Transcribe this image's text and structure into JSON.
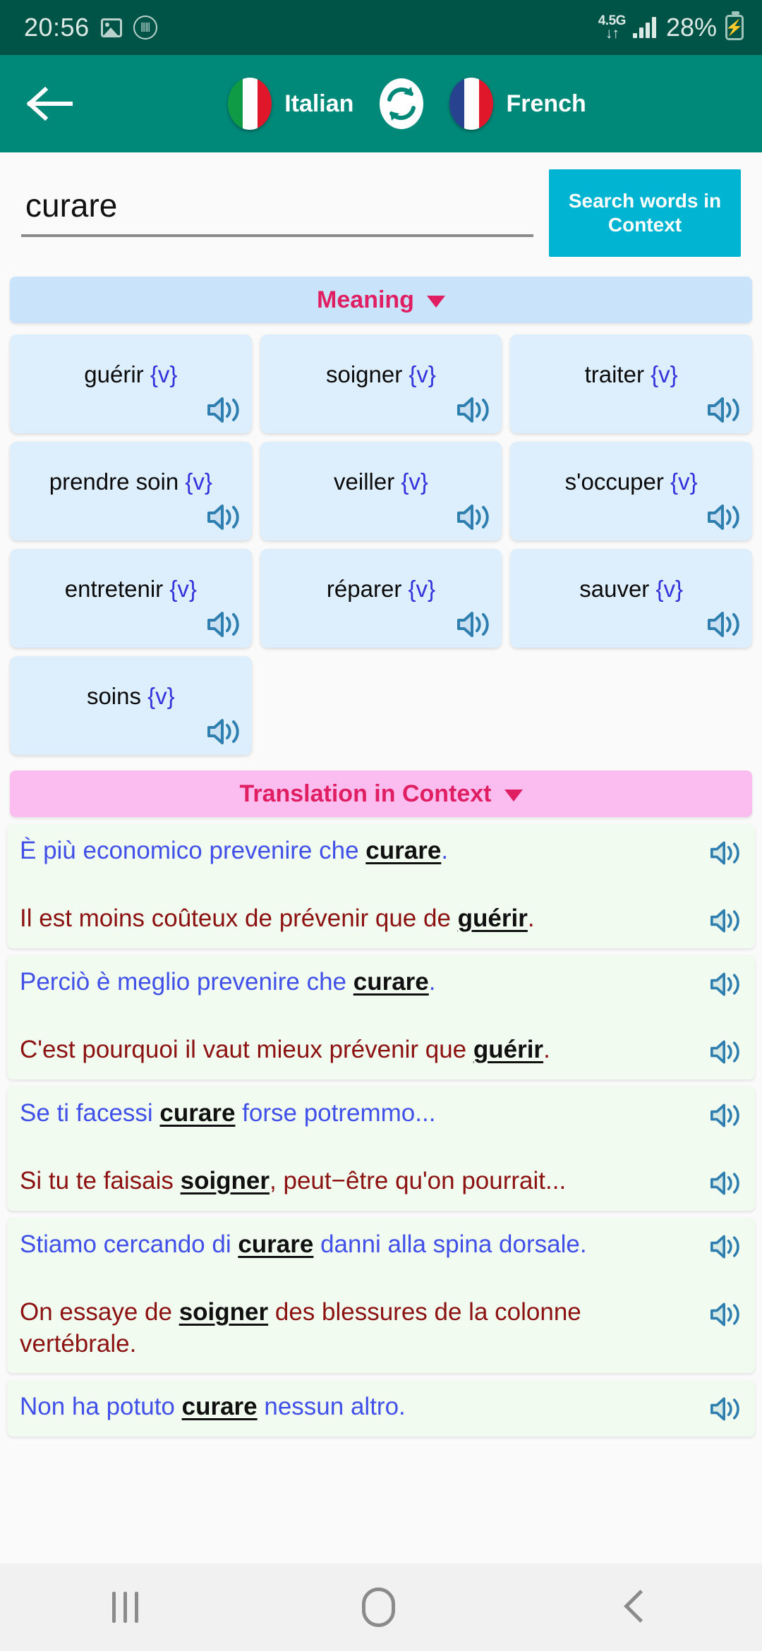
{
  "status_bar": {
    "time": "20:56",
    "image_icon": "image-icon",
    "audio_icon": "audio-wave-icon",
    "network_type": "4.5G",
    "data_arrows": "↓↑",
    "signal_icon": "signal-bars-icon",
    "battery_percent": "28%",
    "battery_icon": "battery-charging-icon",
    "bg_color": "#005447"
  },
  "header": {
    "back_icon": "back-arrow-icon",
    "source_language": "Italian",
    "source_flag": "italy-flag-icon",
    "swap_icon": "swap-languages-icon",
    "target_language": "French",
    "target_flag": "france-flag-icon",
    "bg_color": "#008878"
  },
  "search": {
    "value": "curare",
    "placeholder": "curare",
    "button_label": "Search words in Context",
    "button_color": "#00b4d2"
  },
  "meaning_section": {
    "title": "Meaning",
    "chevron": "chevron-down-icon",
    "bar_color": "#c9e3fb",
    "title_color": "#e01f63",
    "items": [
      {
        "word": "guérir",
        "pos": "{v}",
        "speaker": "speaker-icon"
      },
      {
        "word": "soigner",
        "pos": "{v}",
        "speaker": "speaker-icon"
      },
      {
        "word": "traiter",
        "pos": "{v}",
        "speaker": "speaker-icon"
      },
      {
        "word": "prendre soin",
        "pos": "{v}",
        "speaker": "speaker-icon"
      },
      {
        "word": "veiller",
        "pos": "{v}",
        "speaker": "speaker-icon"
      },
      {
        "word": "s'occuper",
        "pos": "{v}",
        "speaker": "speaker-icon"
      },
      {
        "word": "entretenir",
        "pos": "{v}",
        "speaker": "speaker-icon"
      },
      {
        "word": "réparer",
        "pos": "{v}",
        "speaker": "speaker-icon"
      },
      {
        "word": "sauver",
        "pos": "{v}",
        "speaker": "speaker-icon"
      },
      {
        "word": "soins",
        "pos": "{v}",
        "speaker": "speaker-icon"
      }
    ]
  },
  "context_section": {
    "title": "Translation in Context",
    "chevron": "chevron-down-icon",
    "bar_color": "#fbbdf0",
    "title_color": "#e01f63",
    "pairs": [
      {
        "it_pre": "È più economico prevenire che ",
        "it_key": "curare",
        "it_post": ".",
        "fr_pre": "Il est moins coûteux de prévenir que de ",
        "fr_key": "guérir",
        "fr_post": "."
      },
      {
        "it_pre": "Perciò è meglio prevenire che ",
        "it_key": "curare",
        "it_post": ".",
        "fr_pre": "C'est pourquoi il vaut mieux prévenir que ",
        "fr_key": "guérir",
        "fr_post": "."
      },
      {
        "it_pre": "Se ti facessi ",
        "it_key": "curare",
        "it_post": " forse potremmo...",
        "fr_pre": "Si tu te faisais ",
        "fr_key": "soigner",
        "fr_post": ", peut−être qu'on pourrait..."
      },
      {
        "it_pre": "Stiamo cercando di ",
        "it_key": "curare",
        "it_post": " danni alla spina dorsale.",
        "fr_pre": "On essaye de ",
        "fr_key": "soigner",
        "fr_post": " des blessures de la colonne vertébrale."
      },
      {
        "it_pre": "Non ha potuto ",
        "it_key": "curare",
        "it_post": " nessun altro.",
        "fr_pre": "",
        "fr_key": "",
        "fr_post": ""
      }
    ]
  },
  "nav_bar": {
    "recents_icon": "recents-icon",
    "home_icon": "home-icon",
    "back_icon": "back-icon"
  }
}
